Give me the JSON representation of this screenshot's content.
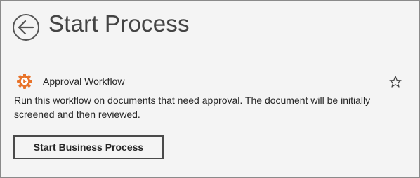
{
  "header": {
    "back_icon": "back-arrow-circle-icon",
    "title": "Start Process"
  },
  "workflow": {
    "icon": "gear-play-icon",
    "icon_color": "#e8732a",
    "name": "Approval Workflow",
    "favorite_icon": "star-outline-icon",
    "description": "Run this workflow on documents that need approval. The document will be initially screened and then reviewed."
  },
  "actions": {
    "start_label": "Start Business Process"
  },
  "colors": {
    "background": "#f4f4f4",
    "border": "#8a8a8a",
    "accent": "#e8732a"
  }
}
